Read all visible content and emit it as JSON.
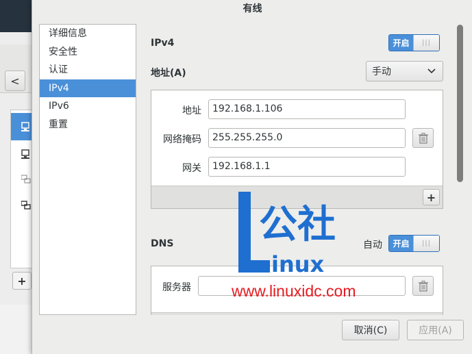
{
  "dialog": {
    "title": "有线"
  },
  "sidebar": {
    "items": [
      {
        "label": "详细信息",
        "active": false
      },
      {
        "label": "安全性",
        "active": false
      },
      {
        "label": "认证",
        "active": false
      },
      {
        "label": "IPv4",
        "active": true
      },
      {
        "label": "IPv6",
        "active": false
      },
      {
        "label": "重置",
        "active": false
      }
    ]
  },
  "ipv4": {
    "title": "IPv4",
    "toggle_label": "开启",
    "address_title": "地址(A)",
    "method_value": "手动",
    "address_label": "地址",
    "address_value": "192.168.1.106",
    "netmask_label": "网络掩码",
    "netmask_value": "255.255.255.0",
    "gateway_label": "网关",
    "gateway_value": "192.168.1.1",
    "add_label": "+"
  },
  "dns": {
    "title": "DNS",
    "auto_label": "自动",
    "toggle_label": "开启",
    "server_label": "服务器",
    "server_value": ""
  },
  "footer": {
    "cancel_label": "取消(C)",
    "apply_label": "应用(A)"
  },
  "background_window": {
    "back_label": "<",
    "add_label": "+"
  },
  "watermark": {
    "logo_text": "公社",
    "brand_text": "inux",
    "url_text": "www.linuxidc.com"
  },
  "colors": {
    "accent": "#4a90d9",
    "watermark_blue": "#1e6fd0",
    "watermark_red": "#e8191f"
  }
}
